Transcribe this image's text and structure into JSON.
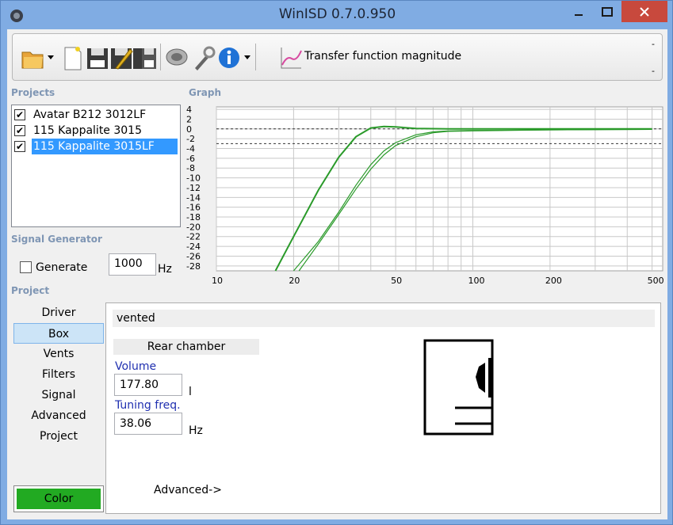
{
  "window": {
    "title": "WinISD 0.7.0.950"
  },
  "toolbar": {
    "buttons": [
      "open-folder-icon",
      "new-document-icon",
      "save-icon",
      "save-as-icon",
      "save-all-icon",
      "speaker-driver-icon",
      "settings-wrench-icon",
      "info-icon",
      "graph-icon"
    ],
    "graph_selector": "Transfer function magnitude",
    "dash_top": "-",
    "dash_bottom": "-"
  },
  "labels": {
    "projects": "Projects",
    "graph": "Graph",
    "signal_generator": "Signal Generator",
    "project": "Project"
  },
  "projects": [
    {
      "name": "Avatar B212 3012LF",
      "checked": true,
      "selected": false
    },
    {
      "name": "115 Kappalite 3015",
      "checked": true,
      "selected": false
    },
    {
      "name": "115 Kappalite 3015LF",
      "checked": true,
      "selected": true
    }
  ],
  "signal_generator": {
    "generate_label": "Generate",
    "generate_checked": false,
    "frequency": "1000",
    "unit": "Hz"
  },
  "nav": [
    "Driver",
    "Box",
    "Vents",
    "Filters",
    "Signal",
    "Advanced",
    "Project"
  ],
  "nav_selected": "Box",
  "color_button": "Color",
  "box": {
    "type": "vented",
    "chamber": "Rear chamber",
    "volume_label": "Volume",
    "volume": "177.80",
    "volume_unit": "l",
    "tuning_label": "Tuning freq.",
    "tuning": "38.06",
    "tuning_unit": "Hz",
    "advanced_link": "Advanced->"
  },
  "chart_data": {
    "type": "line",
    "title": "",
    "xlabel": "",
    "ylabel": "",
    "xscale": "log",
    "xlim": [
      10,
      550
    ],
    "ylim": [
      -29,
      4.5
    ],
    "x_ticks": [
      "10",
      "20",
      "50",
      "100",
      "200",
      "500"
    ],
    "y_ticks": [
      "4",
      "2",
      "0",
      "-2",
      "-4",
      "-6",
      "-8",
      "-10",
      "-12",
      "-14",
      "-16",
      "-18",
      "-20",
      "-22",
      "-24",
      "-26",
      "-28"
    ],
    "reference_lines": [
      0,
      -3
    ],
    "colors": [
      "#2a9a2a",
      "#2a9a2a",
      "#2a9a2a"
    ],
    "series": [
      {
        "x": [
          17,
          20,
          25,
          30,
          35,
          40,
          45,
          50,
          60,
          80,
          100,
          200,
          500
        ],
        "y": [
          -29,
          -22,
          -12.5,
          -5.8,
          -1.6,
          0.2,
          0.5,
          0.4,
          0.1,
          0.0,
          0.0,
          0.0,
          0.0
        ]
      },
      {
        "x": [
          20,
          25,
          30,
          35,
          40,
          45,
          50,
          60,
          70,
          80,
          100,
          200,
          500
        ],
        "y": [
          -29,
          -23,
          -17,
          -11.5,
          -7.3,
          -4.5,
          -2.8,
          -1.2,
          -0.6,
          -0.4,
          -0.3,
          -0.2,
          -0.1
        ]
      },
      {
        "x": [
          21,
          25,
          30,
          35,
          40,
          45,
          50,
          60,
          70,
          80,
          100,
          200,
          500
        ],
        "y": [
          -29,
          -23.5,
          -17.5,
          -12.3,
          -8.2,
          -5.3,
          -3.4,
          -1.6,
          -0.8,
          -0.5,
          -0.4,
          -0.2,
          -0.1
        ]
      }
    ]
  }
}
